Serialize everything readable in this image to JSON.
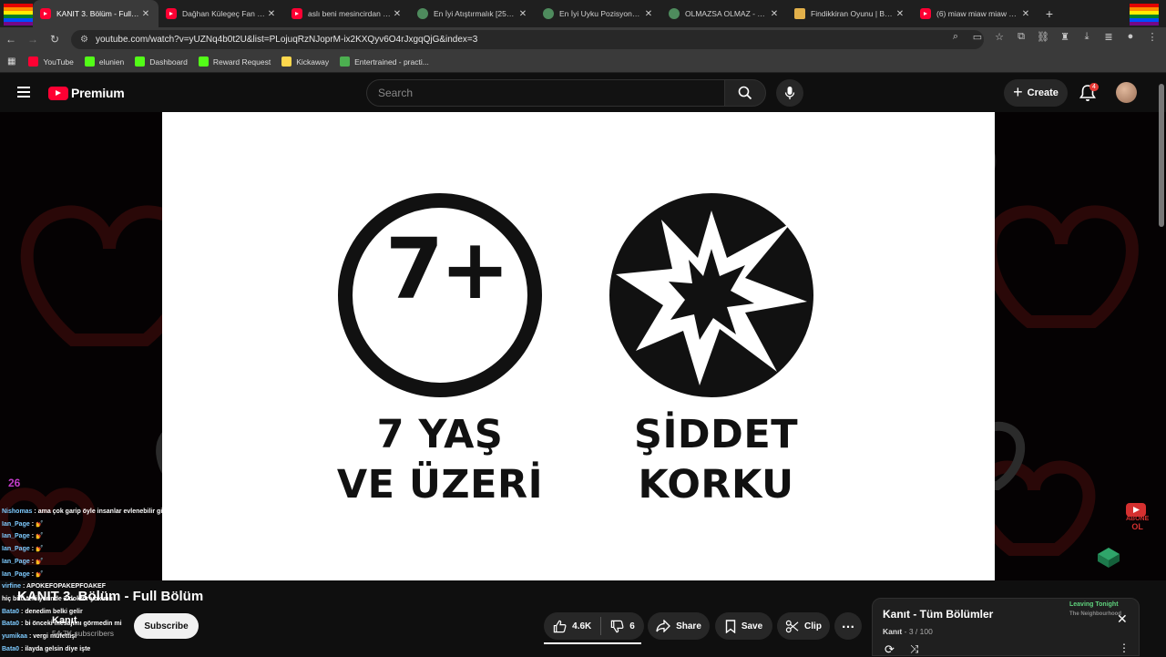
{
  "browser": {
    "tabs": [
      {
        "title": "KANIT 3. Bölüm - Full Bölüm",
        "favicon": "youtube",
        "active": true
      },
      {
        "title": "Dağhan Külegeç Fan - YouTube",
        "favicon": "youtube"
      },
      {
        "title": "aslı beni mesincirdan arar",
        "favicon": "youtube"
      },
      {
        "title": "En İyi Atıştırmalık [256] - Tier",
        "favicon": "globe"
      },
      {
        "title": "En İyi Uyku Pozisyonu #1",
        "favicon": "globe"
      },
      {
        "title": "OLMAZSA OLMAZ - Tier",
        "favicon": "globe"
      },
      {
        "title": "Findikkiran Oyunu | Bedava",
        "favicon": "nf"
      },
      {
        "title": "(6) miaw miaw miaw song",
        "favicon": "youtube"
      }
    ],
    "url": "youtube.com/watch?v=yUZNq4b0t2U&list=PLojuqRzNJoprM-ix2KXQyv6O4rJxgqQjG&index=3",
    "bookmarks": [
      {
        "label": "YouTube",
        "icon": "youtube-icon",
        "color": "#ff0033"
      },
      {
        "label": "elunien",
        "icon": "kick-icon",
        "color": "#53fc18"
      },
      {
        "label": "Dashboard",
        "icon": "kick-icon",
        "color": "#53fc18"
      },
      {
        "label": "Reward Request",
        "icon": "kick-icon",
        "color": "#53fc18"
      },
      {
        "label": "Kickaway",
        "icon": "kickaway-icon",
        "color": "#ffd84d"
      },
      {
        "label": "Entertrained - practi...",
        "icon": "train-icon",
        "color": "#4caf50"
      }
    ]
  },
  "header": {
    "logo_text": "Premium",
    "search_placeholder": "Search",
    "create_label": "Create",
    "notification_count": "4"
  },
  "video": {
    "rating_age": "7+",
    "rating_age_line1": "7 YAŞ",
    "rating_age_line2": "VE ÜZERİ",
    "rating_content_line1": "ŞİDDET",
    "rating_content_line2": "KORKU",
    "overlay_score": "26",
    "abone_line1": "ABONE",
    "abone_line2": "OL"
  },
  "chat": [
    {
      "user": "Nishomas",
      "text": "ama çok garip öyle insanlar evlenebilir gibi geliniyo"
    },
    {
      "user": "Ian_Page",
      "text": "💅"
    },
    {
      "user": "Ian_Page",
      "text": "💅"
    },
    {
      "user": "Ian_Page",
      "text": "💅"
    },
    {
      "user": "Ian_Page",
      "text": "💅"
    },
    {
      "user": "Ian_Page",
      "text": "💅"
    },
    {
      "user": "virfine",
      "text": "APOKEFOPAKEPFOAKEF"
    },
    {
      "user": "",
      "text": "hiç bitti teki yerinde 2 doktor yok mu"
    },
    {
      "user": "Bata0",
      "text": "denedim belki gelir"
    },
    {
      "user": "Bata0",
      "text": "bi önceki mesajımı görmedin mi"
    },
    {
      "user": "yumikaa",
      "text": "vergi müfettişi"
    },
    {
      "user": "Bata0",
      "text": "ilayda gelsin diye işte"
    }
  ],
  "meta": {
    "title": "KANIT 3. Bölüm - Full Bölüm",
    "channel": "Kanıt",
    "subscribers": "54.7K subscribers",
    "subscribe_label": "Subscribe",
    "likes": "4.6K",
    "dislikes": "6",
    "share_label": "Share",
    "save_label": "Save",
    "clip_label": "Clip"
  },
  "playlist": {
    "title": "Kanıt - Tüm Bölümler",
    "owner": "Kanıt",
    "position": "3 / 100",
    "next_label": "Leaving Tonight",
    "next_channel": "The Neighbourhood"
  },
  "colors": {
    "accent": "#ff0033",
    "chat_user": "#7ecbff",
    "score": "#c23cc9"
  }
}
